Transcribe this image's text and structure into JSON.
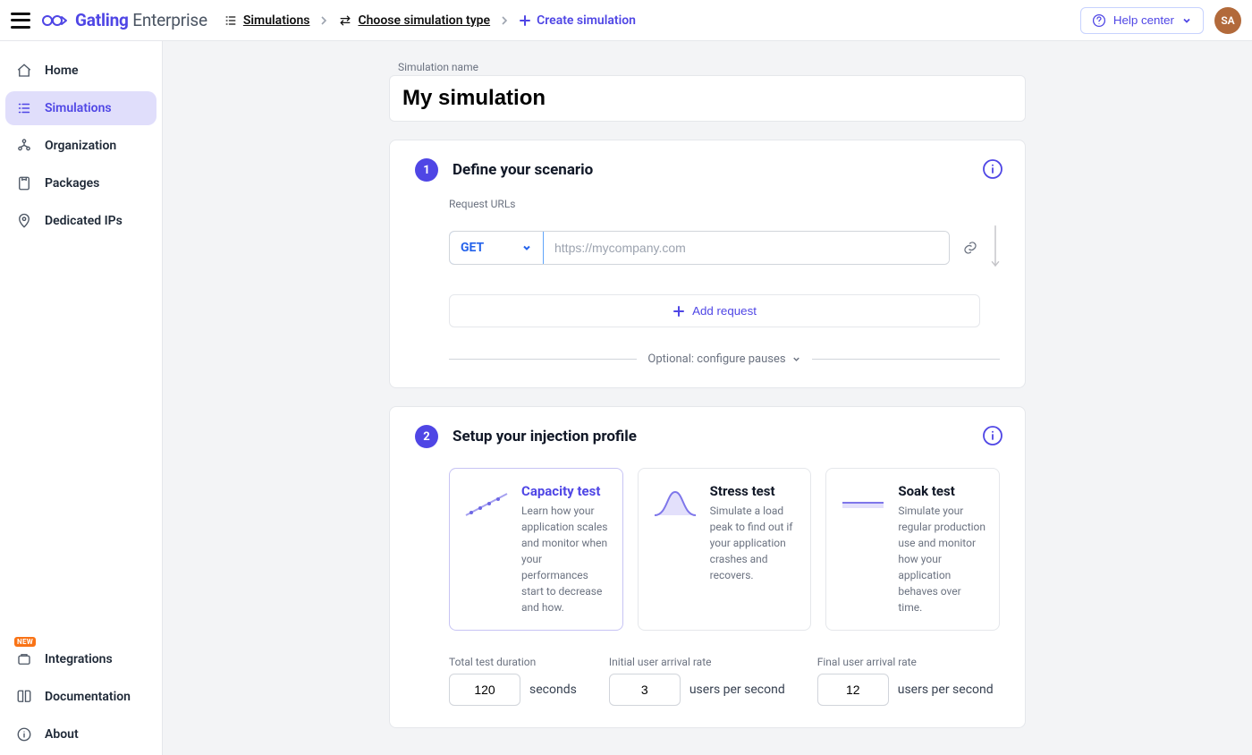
{
  "brand": {
    "name_bold": "Gatling",
    "name_light": " Enterprise"
  },
  "breadcrumbs": {
    "sim": "Simulations",
    "choose": "Choose simulation type",
    "create": "Create simulation"
  },
  "header": {
    "help": "Help center",
    "avatar": "SA"
  },
  "sidebar": {
    "top": [
      {
        "label": "Home"
      },
      {
        "label": "Simulations"
      },
      {
        "label": "Organization"
      },
      {
        "label": "Packages"
      },
      {
        "label": "Dedicated IPs"
      }
    ],
    "bottom": [
      {
        "label": "Integrations",
        "badge": "NEW"
      },
      {
        "label": "Documentation"
      },
      {
        "label": "About"
      }
    ]
  },
  "sim": {
    "name_label": "Simulation name",
    "name_value": "My simulation"
  },
  "step1": {
    "num": "1",
    "title": "Define your scenario",
    "url_label": "Request URLs",
    "method": "GET",
    "url_placeholder": "https://mycompany.com",
    "add_request": "Add request",
    "pauses": "Optional: configure pauses"
  },
  "step2": {
    "num": "2",
    "title": "Setup your injection profile",
    "profiles": [
      {
        "title": "Capacity test",
        "desc": "Learn how your application scales and monitor when your performances start to decrease and how."
      },
      {
        "title": "Stress test",
        "desc": "Simulate a load peak to find out if your application crashes and recovers."
      },
      {
        "title": "Soak test",
        "desc": "Simulate your regular production use and monitor how your application behaves over time."
      }
    ],
    "params": {
      "duration_label": "Total test duration",
      "duration_value": "120",
      "duration_unit": "seconds",
      "initial_label": "Initial user arrival rate",
      "initial_value": "3",
      "initial_unit": "users per second",
      "final_label": "Final user arrival rate",
      "final_value": "12",
      "final_unit": "users per second"
    }
  }
}
